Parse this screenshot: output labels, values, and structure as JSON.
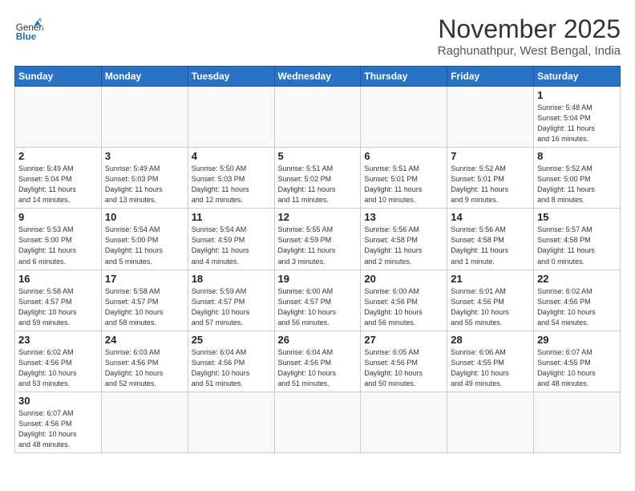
{
  "header": {
    "logo_general": "General",
    "logo_blue": "Blue",
    "month_year": "November 2025",
    "location": "Raghunathpur, West Bengal, India"
  },
  "weekdays": [
    "Sunday",
    "Monday",
    "Tuesday",
    "Wednesday",
    "Thursday",
    "Friday",
    "Saturday"
  ],
  "weeks": [
    [
      {
        "day": "",
        "info": ""
      },
      {
        "day": "",
        "info": ""
      },
      {
        "day": "",
        "info": ""
      },
      {
        "day": "",
        "info": ""
      },
      {
        "day": "",
        "info": ""
      },
      {
        "day": "",
        "info": ""
      },
      {
        "day": "1",
        "info": "Sunrise: 5:48 AM\nSunset: 5:04 PM\nDaylight: 11 hours\nand 16 minutes."
      }
    ],
    [
      {
        "day": "2",
        "info": "Sunrise: 5:49 AM\nSunset: 5:04 PM\nDaylight: 11 hours\nand 14 minutes."
      },
      {
        "day": "3",
        "info": "Sunrise: 5:49 AM\nSunset: 5:03 PM\nDaylight: 11 hours\nand 13 minutes."
      },
      {
        "day": "4",
        "info": "Sunrise: 5:50 AM\nSunset: 5:03 PM\nDaylight: 11 hours\nand 12 minutes."
      },
      {
        "day": "5",
        "info": "Sunrise: 5:51 AM\nSunset: 5:02 PM\nDaylight: 11 hours\nand 11 minutes."
      },
      {
        "day": "6",
        "info": "Sunrise: 5:51 AM\nSunset: 5:01 PM\nDaylight: 11 hours\nand 10 minutes."
      },
      {
        "day": "7",
        "info": "Sunrise: 5:52 AM\nSunset: 5:01 PM\nDaylight: 11 hours\nand 9 minutes."
      },
      {
        "day": "8",
        "info": "Sunrise: 5:52 AM\nSunset: 5:00 PM\nDaylight: 11 hours\nand 8 minutes."
      }
    ],
    [
      {
        "day": "9",
        "info": "Sunrise: 5:53 AM\nSunset: 5:00 PM\nDaylight: 11 hours\nand 6 minutes."
      },
      {
        "day": "10",
        "info": "Sunrise: 5:54 AM\nSunset: 5:00 PM\nDaylight: 11 hours\nand 5 minutes."
      },
      {
        "day": "11",
        "info": "Sunrise: 5:54 AM\nSunset: 4:59 PM\nDaylight: 11 hours\nand 4 minutes."
      },
      {
        "day": "12",
        "info": "Sunrise: 5:55 AM\nSunset: 4:59 PM\nDaylight: 11 hours\nand 3 minutes."
      },
      {
        "day": "13",
        "info": "Sunrise: 5:56 AM\nSunset: 4:58 PM\nDaylight: 11 hours\nand 2 minutes."
      },
      {
        "day": "14",
        "info": "Sunrise: 5:56 AM\nSunset: 4:58 PM\nDaylight: 11 hours\nand 1 minute."
      },
      {
        "day": "15",
        "info": "Sunrise: 5:57 AM\nSunset: 4:58 PM\nDaylight: 11 hours\nand 0 minutes."
      }
    ],
    [
      {
        "day": "16",
        "info": "Sunrise: 5:58 AM\nSunset: 4:57 PM\nDaylight: 10 hours\nand 59 minutes."
      },
      {
        "day": "17",
        "info": "Sunrise: 5:58 AM\nSunset: 4:57 PM\nDaylight: 10 hours\nand 58 minutes."
      },
      {
        "day": "18",
        "info": "Sunrise: 5:59 AM\nSunset: 4:57 PM\nDaylight: 10 hours\nand 57 minutes."
      },
      {
        "day": "19",
        "info": "Sunrise: 6:00 AM\nSunset: 4:57 PM\nDaylight: 10 hours\nand 56 minutes."
      },
      {
        "day": "20",
        "info": "Sunrise: 6:00 AM\nSunset: 4:56 PM\nDaylight: 10 hours\nand 56 minutes."
      },
      {
        "day": "21",
        "info": "Sunrise: 6:01 AM\nSunset: 4:56 PM\nDaylight: 10 hours\nand 55 minutes."
      },
      {
        "day": "22",
        "info": "Sunrise: 6:02 AM\nSunset: 4:56 PM\nDaylight: 10 hours\nand 54 minutes."
      }
    ],
    [
      {
        "day": "23",
        "info": "Sunrise: 6:02 AM\nSunset: 4:56 PM\nDaylight: 10 hours\nand 53 minutes."
      },
      {
        "day": "24",
        "info": "Sunrise: 6:03 AM\nSunset: 4:56 PM\nDaylight: 10 hours\nand 52 minutes."
      },
      {
        "day": "25",
        "info": "Sunrise: 6:04 AM\nSunset: 4:56 PM\nDaylight: 10 hours\nand 51 minutes."
      },
      {
        "day": "26",
        "info": "Sunrise: 6:04 AM\nSunset: 4:56 PM\nDaylight: 10 hours\nand 51 minutes."
      },
      {
        "day": "27",
        "info": "Sunrise: 6:05 AM\nSunset: 4:56 PM\nDaylight: 10 hours\nand 50 minutes."
      },
      {
        "day": "28",
        "info": "Sunrise: 6:06 AM\nSunset: 4:55 PM\nDaylight: 10 hours\nand 49 minutes."
      },
      {
        "day": "29",
        "info": "Sunrise: 6:07 AM\nSunset: 4:55 PM\nDaylight: 10 hours\nand 48 minutes."
      }
    ],
    [
      {
        "day": "30",
        "info": "Sunrise: 6:07 AM\nSunset: 4:56 PM\nDaylight: 10 hours\nand 48 minutes."
      },
      {
        "day": "",
        "info": ""
      },
      {
        "day": "",
        "info": ""
      },
      {
        "day": "",
        "info": ""
      },
      {
        "day": "",
        "info": ""
      },
      {
        "day": "",
        "info": ""
      },
      {
        "day": "",
        "info": ""
      }
    ]
  ]
}
